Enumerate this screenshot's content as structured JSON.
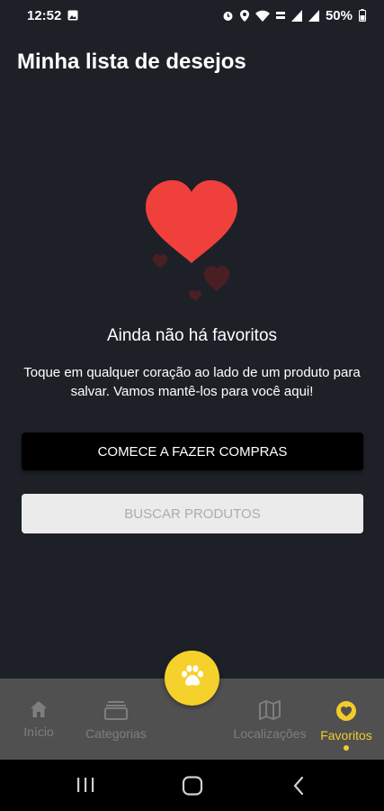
{
  "status_bar": {
    "time": "12:52",
    "battery": "50%",
    "icons": [
      "image-icon",
      "alarm-icon",
      "location-icon",
      "wifi-icon",
      "volte-icon",
      "signal-icon",
      "signal-icon",
      "battery-icon"
    ]
  },
  "header": {
    "title": "Minha lista de desejos"
  },
  "empty_state": {
    "illustration": "hearts-icon",
    "title": "Ainda não há favoritos",
    "description": "Toque em qualquer coração ao lado de um produto para salvar. Vamos mantê-los para você aqui!",
    "primary_button": "COMECE A FAZER COMPRAS",
    "secondary_button": "BUSCAR PRODUTOS"
  },
  "bottom_nav": {
    "items": [
      {
        "label": "Início",
        "icon": "home-icon",
        "active": false
      },
      {
        "label": "Categorias",
        "icon": "categories-icon",
        "active": false
      },
      {
        "label": "Localizações",
        "icon": "map-icon",
        "active": false
      },
      {
        "label": "Favoritos",
        "icon": "heart-icon",
        "active": true
      }
    ],
    "center_button_icon": "paw-icon"
  },
  "system_nav": {
    "icons": [
      "recents-icon",
      "home-icon",
      "back-icon"
    ]
  },
  "colors": {
    "background": "#1e2028",
    "accent": "#f3cc2a",
    "heart": "#f0403c",
    "nav_background": "#505050",
    "nav_inactive": "#7e7e7e"
  }
}
